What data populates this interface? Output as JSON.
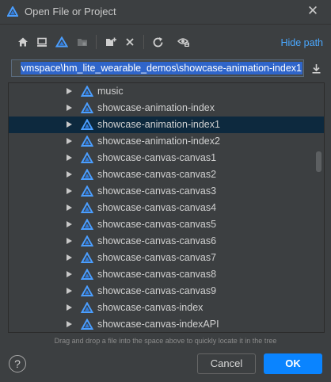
{
  "window": {
    "title": "Open File or Project",
    "close_label": "✕"
  },
  "toolbar": {
    "buttons": [
      {
        "name": "home-button",
        "icon": "home-icon"
      },
      {
        "name": "desktop-button",
        "icon": "desktop-icon"
      },
      {
        "name": "project-button",
        "icon": "deveco-logo-icon"
      },
      {
        "name": "module-button",
        "icon": "folder-module-icon"
      },
      {
        "name": "new-folder-button",
        "icon": "new-folder-icon"
      },
      {
        "name": "delete-button",
        "icon": "delete-icon"
      },
      {
        "name": "refresh-button",
        "icon": "refresh-icon"
      },
      {
        "name": "show-hidden-button",
        "icon": "show-hidden-icon"
      }
    ],
    "hide_path_label": "Hide path"
  },
  "path": {
    "value": "vmspace\\hm_lite_wearable_demos\\showcase-animation-index1"
  },
  "tree": {
    "items": [
      {
        "label": "music",
        "selected": false
      },
      {
        "label": "showcase-animation-index",
        "selected": false
      },
      {
        "label": "showcase-animation-index1",
        "selected": true
      },
      {
        "label": "showcase-animation-index2",
        "selected": false
      },
      {
        "label": "showcase-canvas-canvas1",
        "selected": false
      },
      {
        "label": "showcase-canvas-canvas2",
        "selected": false
      },
      {
        "label": "showcase-canvas-canvas3",
        "selected": false
      },
      {
        "label": "showcase-canvas-canvas4",
        "selected": false
      },
      {
        "label": "showcase-canvas-canvas5",
        "selected": false
      },
      {
        "label": "showcase-canvas-canvas6",
        "selected": false
      },
      {
        "label": "showcase-canvas-canvas7",
        "selected": false
      },
      {
        "label": "showcase-canvas-canvas8",
        "selected": false
      },
      {
        "label": "showcase-canvas-canvas9",
        "selected": false
      },
      {
        "label": "showcase-canvas-index",
        "selected": false
      },
      {
        "label": "showcase-canvas-indexAPI",
        "selected": false
      }
    ]
  },
  "hint": "Drag and drop a file into the space above to quickly locate it in the tree",
  "footer": {
    "help_label": "?",
    "cancel_label": "Cancel",
    "ok_label": "OK"
  },
  "colors": {
    "background": "#3c3f41",
    "accent": "#0a84ff",
    "link": "#4aa8ff",
    "selection": "#0d293e",
    "path_highlight": "#2f65ca"
  }
}
